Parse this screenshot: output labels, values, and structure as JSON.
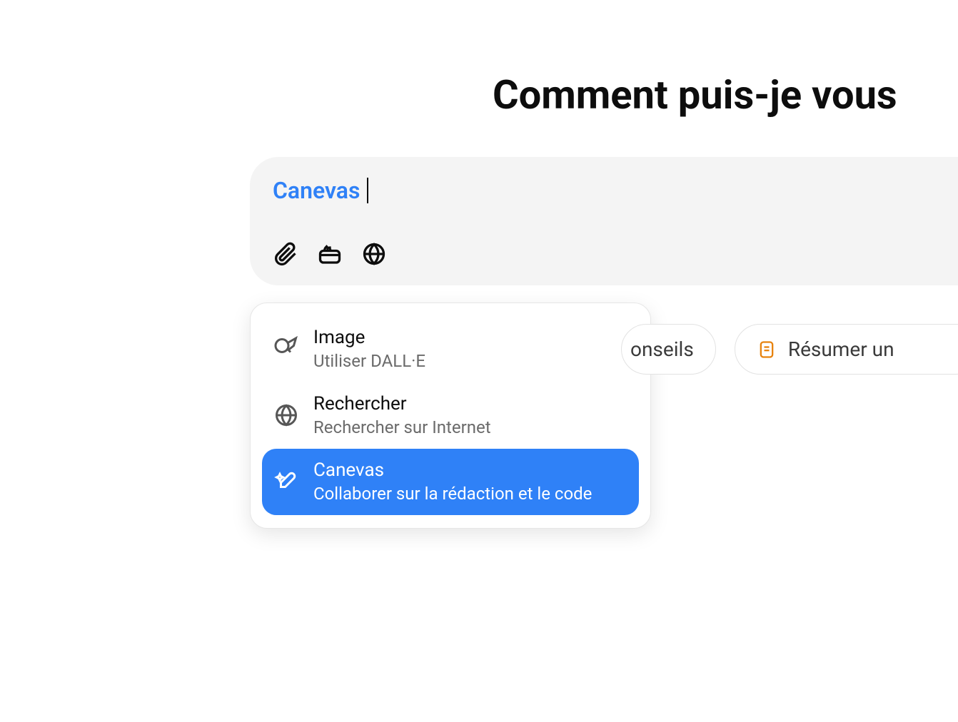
{
  "heading": "Comment puis-je vous",
  "input": {
    "chip_text": "Canevas"
  },
  "dropdown": {
    "items": [
      {
        "title": "Image",
        "subtitle": "Utiliser DALL·E",
        "selected": false,
        "icon": "brush"
      },
      {
        "title": "Rechercher",
        "subtitle": "Rechercher sur Internet",
        "selected": false,
        "icon": "globe"
      },
      {
        "title": "Canevas",
        "subtitle": "Collaborer sur la rédaction et le code",
        "selected": true,
        "icon": "sparkle-pen"
      }
    ]
  },
  "suggestions": [
    {
      "label": "onseils",
      "partial": "left"
    },
    {
      "label": "Résumer un",
      "partial": "right"
    }
  ]
}
